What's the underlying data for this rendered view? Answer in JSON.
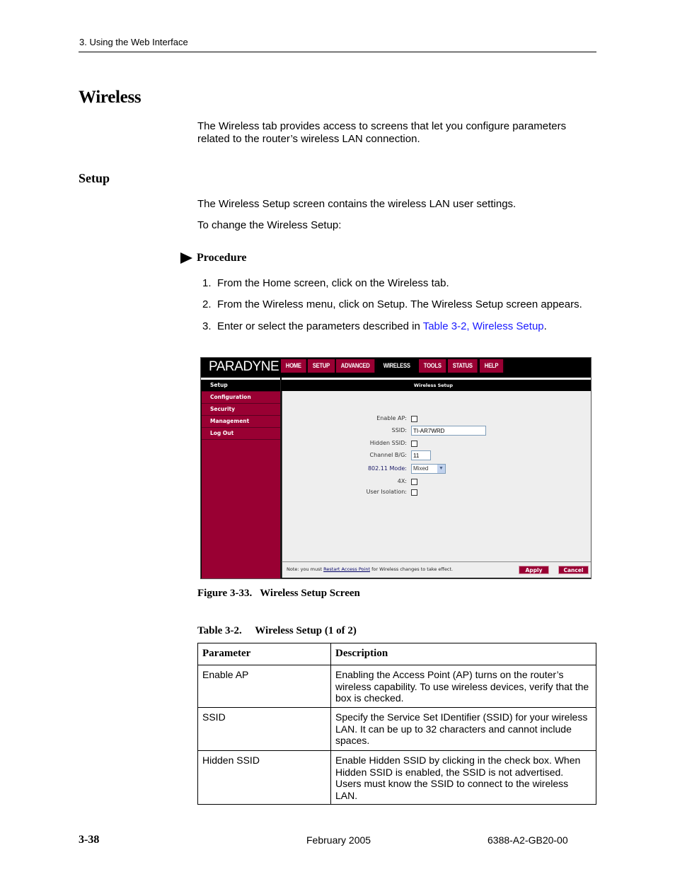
{
  "running_head": "3. Using the Web Interface",
  "section_title": "Wireless",
  "intro": "The Wireless tab provides access to screens that let you configure parameters related to the router’s wireless LAN connection.",
  "subsection_title": "Setup",
  "setup_para": "The Wireless Setup screen contains the wireless LAN user settings.",
  "change_para": "To change the Wireless Setup:",
  "procedure": {
    "label": "Procedure",
    "steps": [
      {
        "num": "1.",
        "text": "From the Home screen, click on the Wireless tab."
      },
      {
        "num": "2.",
        "text": "From the Wireless menu, click on Setup. The Wireless Setup screen appears."
      },
      {
        "num": "3.",
        "text": "Enter or select the parameters described in ",
        "link": "Table 3-2, Wireless Setup",
        "after": "."
      }
    ]
  },
  "screenshot": {
    "logo": "PARADYNE",
    "tabs": [
      {
        "label": "HOME",
        "active": false
      },
      {
        "label": "SETUP",
        "active": false
      },
      {
        "label": "ADVANCED",
        "active": false
      },
      {
        "label": "WIRELESS",
        "active": true
      },
      {
        "label": "TOOLS",
        "active": false
      },
      {
        "label": "STATUS",
        "active": false
      },
      {
        "label": "HELP",
        "active": false
      }
    ],
    "sidebar": [
      {
        "label": "Setup",
        "active": true
      },
      {
        "label": "Configuration",
        "active": false
      },
      {
        "label": "Security",
        "active": false
      },
      {
        "label": "Management",
        "active": false
      },
      {
        "label": "Log Out",
        "active": false
      }
    ],
    "header": "Wireless Setup",
    "form": {
      "enable_ap": {
        "label": "Enable AP:",
        "checked": false
      },
      "ssid": {
        "label": "SSID:",
        "value": "TI-AR7WRD"
      },
      "hidden_ssid": {
        "label": "Hidden SSID:",
        "checked": false
      },
      "channel": {
        "label": "Channel B/G:",
        "value": "11"
      },
      "mode": {
        "label": "802.11 Mode:",
        "value": "Mixed"
      },
      "four_x": {
        "label": "4X:",
        "checked": false
      },
      "user_isolation": {
        "label": "User Isolation:",
        "checked": false
      }
    },
    "note_prefix": "Note: you must ",
    "note_link": "Restart Access Point",
    "note_suffix": " for Wireless changes to take effect.",
    "apply_label": "Apply",
    "cancel_label": "Cancel",
    "colors": {
      "brand": "#990033",
      "black": "#000000",
      "panel": "#eeeeee"
    }
  },
  "figure_caption": "Figure 3-33.   Wireless Setup Screen",
  "table_caption": "Table 3-2.     Wireless Setup (1 of 2)",
  "table": {
    "headers": [
      "Parameter",
      "Description"
    ],
    "rows": [
      [
        "Enable AP",
        "Enabling the Access Point (AP) turns on the router’s wireless capability. To use wireless devices, verify that the box is checked."
      ],
      [
        "SSID",
        "Specify the Service Set IDentifier (SSID) for your wireless LAN. It can be up to 32 characters and cannot include spaces."
      ],
      [
        "Hidden SSID",
        "Enable Hidden SSID by clicking in the check box. When Hidden SSID is enabled, the SSID is not advertised. Users must know the SSID to connect to the wireless LAN."
      ]
    ]
  },
  "footer": {
    "page_number": "3-38",
    "date": "February 2005",
    "doc_number": "6388-A2-GB20-00"
  }
}
